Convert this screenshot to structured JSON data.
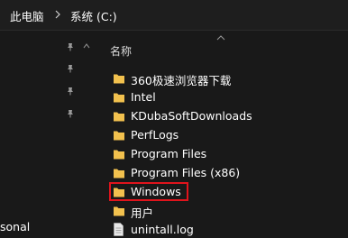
{
  "breadcrumb": {
    "root": "此电脑",
    "current": "系统 (C:)"
  },
  "nav": {
    "partial_item": "sonal"
  },
  "list": {
    "column_name": "名称",
    "items": [
      {
        "label": "360极速浏览器下载",
        "type": "folder"
      },
      {
        "label": "Intel",
        "type": "folder"
      },
      {
        "label": "KDubaSoftDownloads",
        "type": "folder"
      },
      {
        "label": "PerfLogs",
        "type": "folder"
      },
      {
        "label": "Program Files",
        "type": "folder"
      },
      {
        "label": "Program Files (x86)",
        "type": "folder"
      },
      {
        "label": "Windows",
        "type": "folder",
        "highlighted": true
      },
      {
        "label": "用户",
        "type": "folder"
      },
      {
        "label": "unintall.log",
        "type": "file"
      }
    ]
  },
  "colors": {
    "background": "#191919",
    "folder": "#f2c14e",
    "highlight": "#e0141c"
  },
  "icons": {
    "pin": "pin-icon",
    "folder": "folder-icon",
    "file": "file-icon",
    "separator": "chevron-right-icon",
    "sort": "sort-ascending-icon"
  }
}
